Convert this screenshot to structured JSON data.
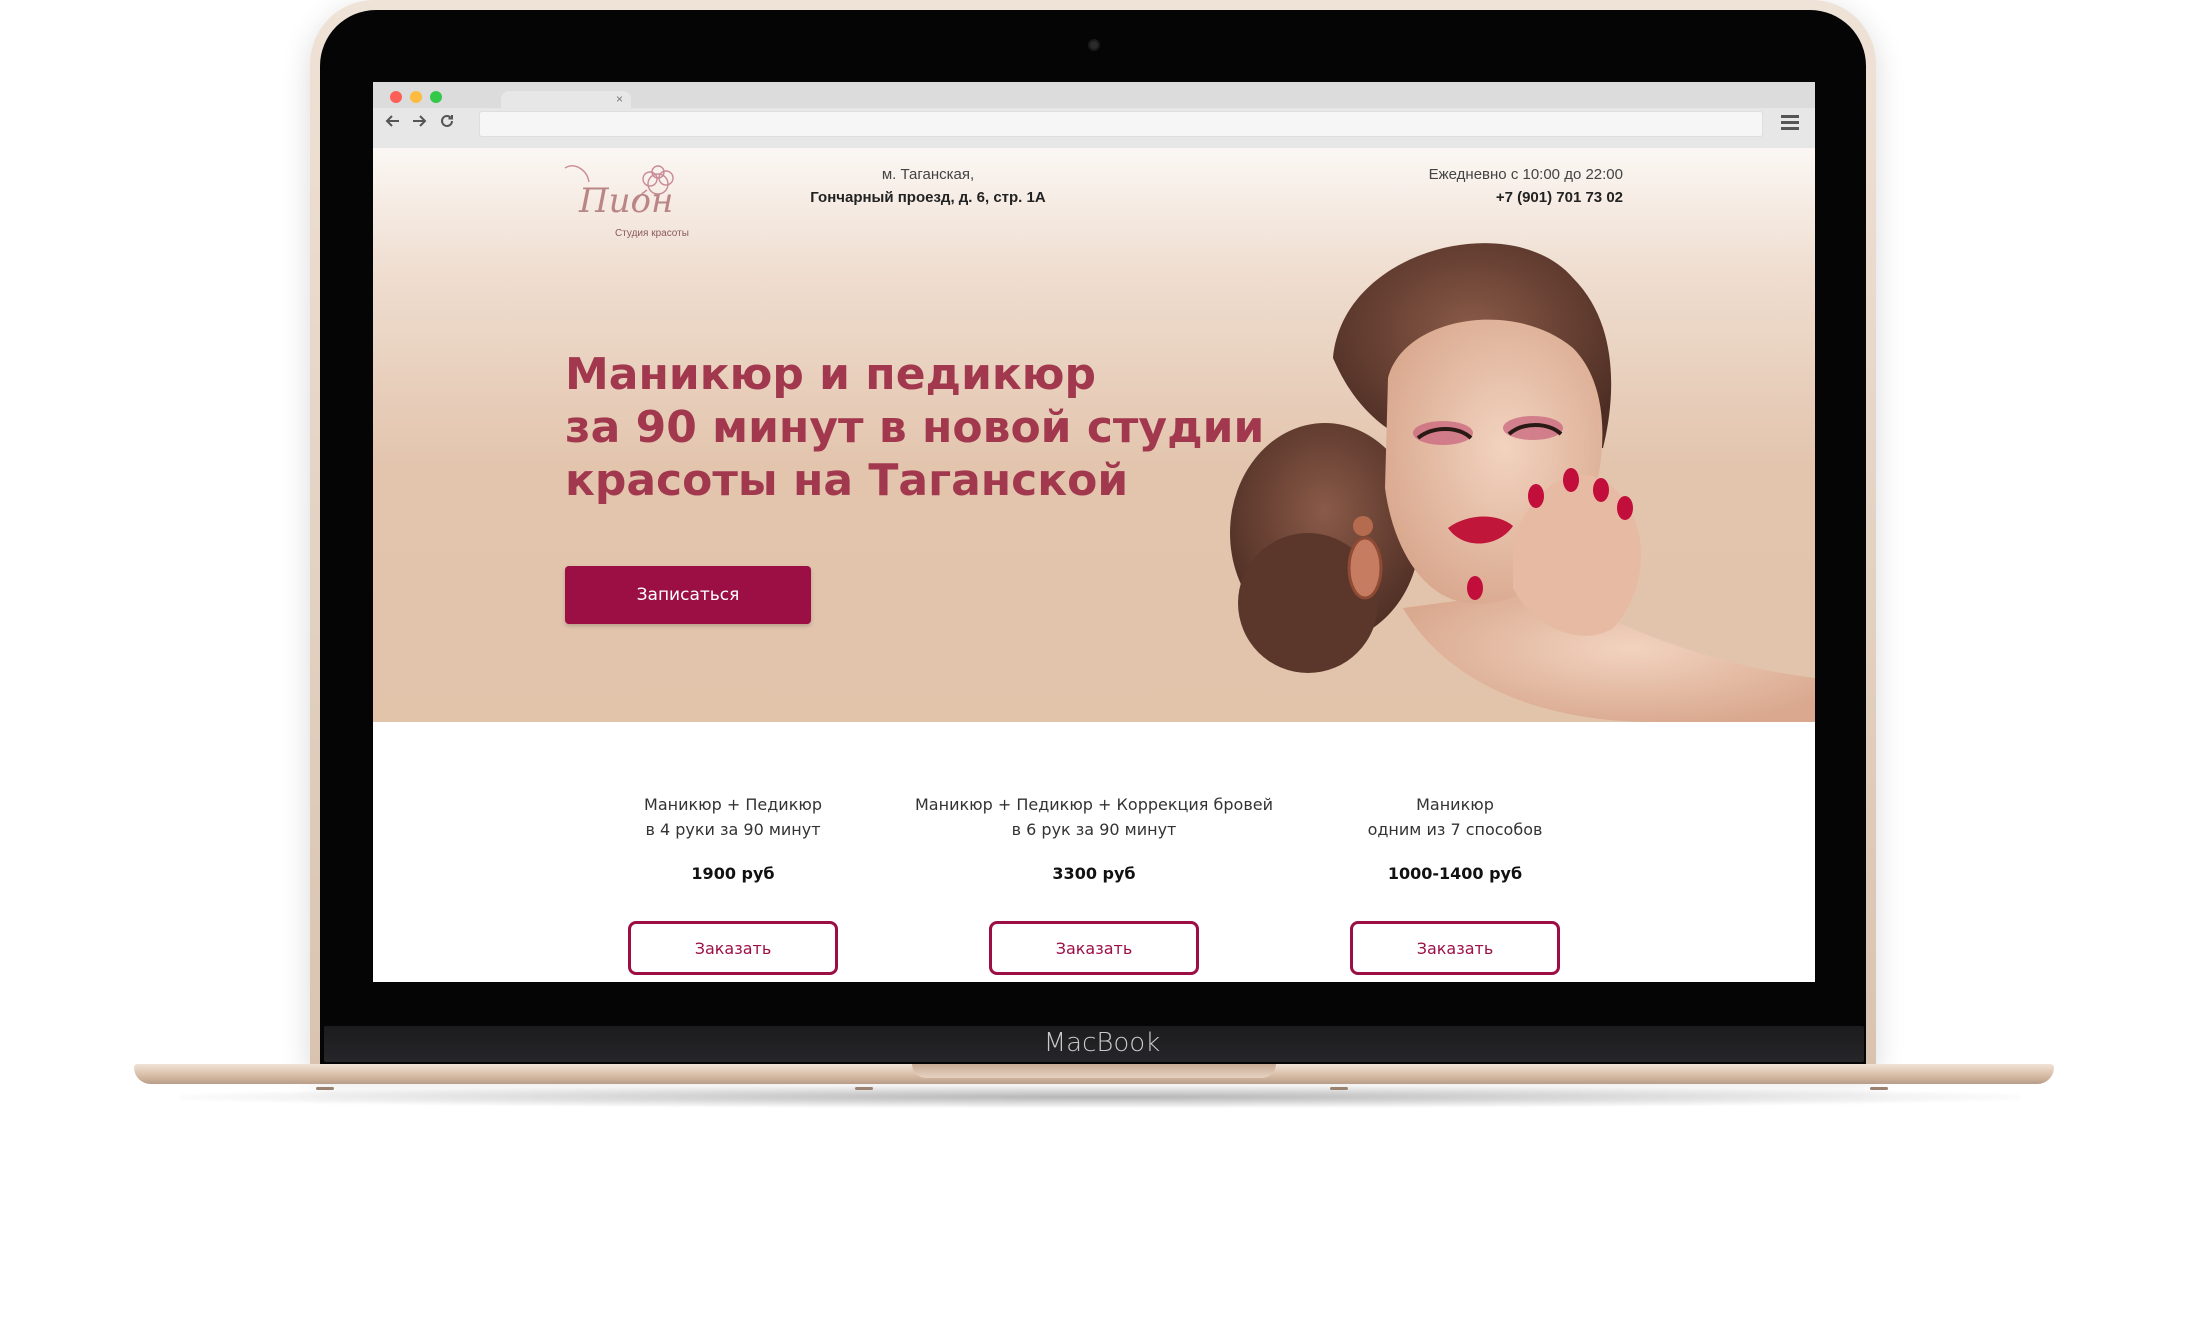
{
  "device": {
    "label": "MacBook"
  },
  "browser": {
    "tab_close": "×",
    "url": "",
    "icons": [
      "back-arrow-icon",
      "forward-arrow-icon",
      "reload-icon",
      "hamburger-menu-icon"
    ]
  },
  "site": {
    "logo": {
      "name": "Пион",
      "subtitle": "Студия красоты"
    },
    "address": {
      "metro": "м. Таганская,",
      "street": "Гончарный проезд, д. 6, стр. 1А"
    },
    "contact": {
      "hours": "Ежедневно с 10:00 до 22:00",
      "phone": "+7 (901) 701 73 02"
    },
    "hero": {
      "headline_lines": [
        "Маникюр и педикюр",
        "за 90 минут в новой студии",
        "красоты на Таганской"
      ],
      "cta_label": "Записаться"
    },
    "services": [
      {
        "line1": "Маникюр + Педикюр",
        "line2": "в 4 руки за 90 минут",
        "price": "1900 руб",
        "button": "Заказать"
      },
      {
        "line1": "Маникюр + Педикюр + Коррекция бровей",
        "line2": "в 6 рук за 90 минут",
        "price": "3300 руб",
        "button": "Заказать"
      },
      {
        "line1": "Маникюр",
        "line2": "одним из 7 способов",
        "price": "1000-1400 руб",
        "button": "Заказать"
      }
    ]
  },
  "colors": {
    "accent": "#9b0f45",
    "headline": "#a2384e",
    "hero_bg": "#e3c5ae",
    "laptop_gold": "#e2cbb8"
  }
}
